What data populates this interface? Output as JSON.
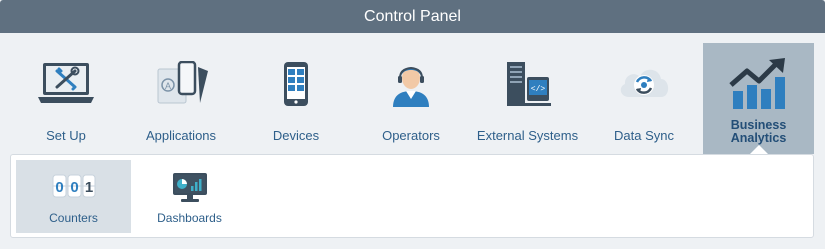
{
  "header": {
    "title": "Control Panel"
  },
  "tabs": [
    {
      "label": "Set Up",
      "icon": "laptop-tools-icon"
    },
    {
      "label": "Applications",
      "icon": "applications-icon"
    },
    {
      "label": "Devices",
      "icon": "tablet-device-icon"
    },
    {
      "label": "Operators",
      "icon": "operator-person-icon"
    },
    {
      "label": "External Systems",
      "icon": "server-code-icon"
    },
    {
      "label": "Data Sync",
      "icon": "cloud-sync-icon"
    },
    {
      "label": "Business Analytics",
      "label_line1": "Business",
      "label_line2": "Analytics",
      "icon": "trend-chart-icon",
      "active": true
    }
  ],
  "subtabs": [
    {
      "label": "Counters",
      "icon": "counter-digits-icon",
      "icon_text": [
        "0",
        "0",
        "1"
      ],
      "active": true
    },
    {
      "label": "Dashboards",
      "icon": "dashboard-monitor-icon"
    }
  ],
  "colors": {
    "header_bg": "#5f7080",
    "active_tab_bg": "#a9b8c4",
    "label_blue": "#2e5f8a",
    "icon_dark": "#3c4e5e",
    "icon_blue": "#2f7fbf"
  }
}
